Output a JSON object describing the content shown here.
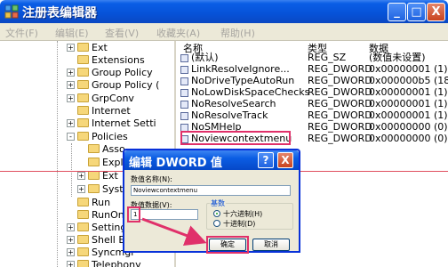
{
  "window": {
    "title": "注册表编辑器",
    "min": "_",
    "max": "□",
    "close": "X"
  },
  "menu": [
    {
      "label": "文件(F)"
    },
    {
      "label": "编辑(E)"
    },
    {
      "label": "查看(V)"
    },
    {
      "label": "收藏夹(A)"
    },
    {
      "label": "帮助(H)"
    }
  ],
  "tree": [
    {
      "label": "Ext",
      "expander": "+"
    },
    {
      "label": "Extensions",
      "expander": ""
    },
    {
      "label": "Group Policy",
      "expander": "+"
    },
    {
      "label": "Group Policy (",
      "expander": "+"
    },
    {
      "label": "GrpConv",
      "expander": "+"
    },
    {
      "label": "Internet",
      "expander": ""
    },
    {
      "label": "Internet Setti",
      "expander": "+"
    },
    {
      "label": "Policies",
      "expander": "-"
    },
    {
      "label": "Asso",
      "expander": ""
    },
    {
      "label": "Expl",
      "expander": ""
    },
    {
      "label": "Ext",
      "expander": "+"
    },
    {
      "label": "Syst",
      "expander": "+"
    },
    {
      "label": "Run",
      "expander": ""
    },
    {
      "label": "RunOnce",
      "expander": ""
    },
    {
      "label": "Setting",
      "expander": "+"
    },
    {
      "label": "Shell E",
      "expander": "+"
    },
    {
      "label": "Syncmgr",
      "expander": "+"
    },
    {
      "label": "Telephony",
      "expander": "+"
    }
  ],
  "list": {
    "headers": {
      "name": "名称",
      "type": "类型",
      "data": "数据"
    },
    "rows": [
      {
        "name": "(默认)",
        "type": "REG_SZ",
        "data": "(数值未设置)",
        "icon": "string-value-icon"
      },
      {
        "name": "LinkResolveIgnore...",
        "type": "REG_DWORD",
        "data": "0x00000001 (1)",
        "icon": "dword-value-icon"
      },
      {
        "name": "NoDriveTypeAutoRun",
        "type": "REG_DWORD",
        "data": "0x000000b5 (18",
        "icon": "dword-value-icon"
      },
      {
        "name": "NoLowDiskSpaceChecks",
        "type": "REG_DWORD",
        "data": "0x00000001 (1)",
        "icon": "dword-value-icon"
      },
      {
        "name": "NoResolveSearch",
        "type": "REG_DWORD",
        "data": "0x00000001 (1)",
        "icon": "dword-value-icon"
      },
      {
        "name": "NoResolveTrack",
        "type": "REG_DWORD",
        "data": "0x00000001 (1)",
        "icon": "dword-value-icon"
      },
      {
        "name": "NoSMHelp",
        "type": "REG_DWORD",
        "data": "0x00000000 (0)",
        "icon": "dword-value-icon"
      },
      {
        "name": "Noviewcontextmenu",
        "type": "REG_DWORD",
        "data": "0x00000000 (0)",
        "icon": "dword-value-icon"
      }
    ]
  },
  "dialog": {
    "title": "编辑 DWORD 值",
    "help": "?",
    "close": "X",
    "name_label": "数值名称(N):",
    "name_value": "Noviewcontextmenu",
    "data_label": "数值数据(V):",
    "data_value": "1",
    "base_label": "基数",
    "hex_label": "十六进制(H)",
    "dec_label": "十进制(D)",
    "ok": "确定",
    "cancel": "取消"
  },
  "colors": {
    "annotation": "#e0306a",
    "titlebar": "#0652d8"
  }
}
